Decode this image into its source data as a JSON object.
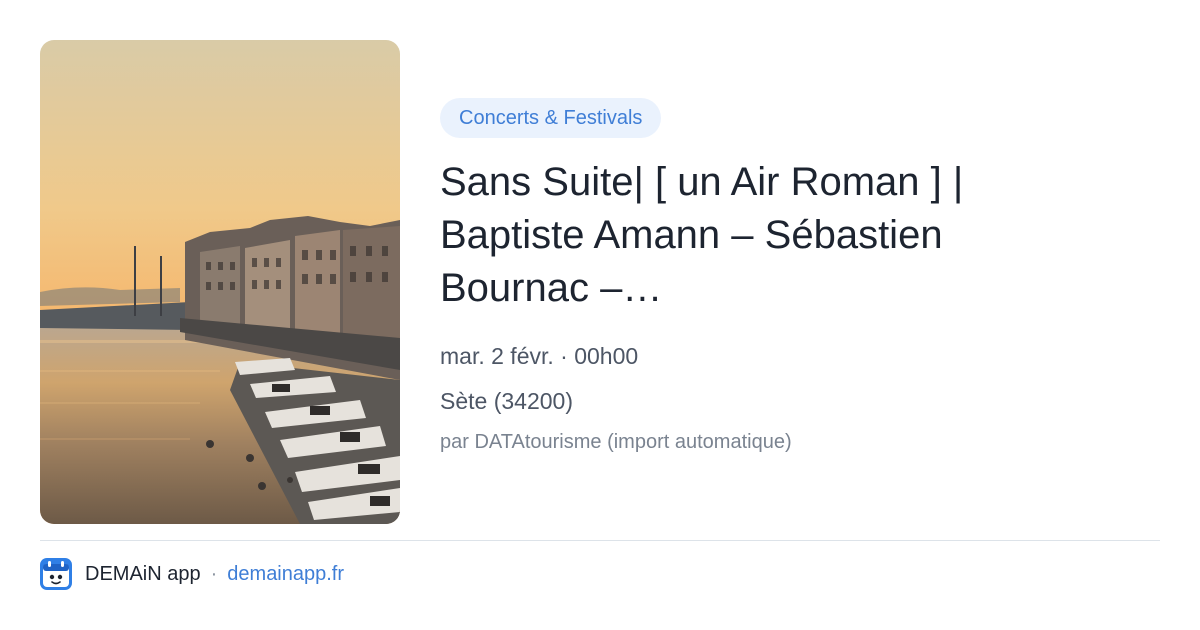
{
  "event": {
    "category": "Concerts & Festivals",
    "title": "Sans Suite| [ un Air Roman ] | Baptiste Amann – Sébastien Bournac –…",
    "date": "mar. 2 févr. · 00h00",
    "location": "Sète (34200)",
    "source": "par DATAtourisme (import automatique)",
    "image_alt": "Quai de Sète au coucher du soleil avec bateaux amarrés"
  },
  "footer": {
    "app_name": "DEMAiN app",
    "separator": "·",
    "url": "demainapp.fr",
    "logo_icon": "demain-app-logo-icon"
  },
  "colors": {
    "accent": "#3f7ed6",
    "chip_bg": "#eaf2fd",
    "title": "#1d2430",
    "meta": "#4d5665",
    "muted": "#7a8390",
    "divider": "#dde3e9"
  }
}
